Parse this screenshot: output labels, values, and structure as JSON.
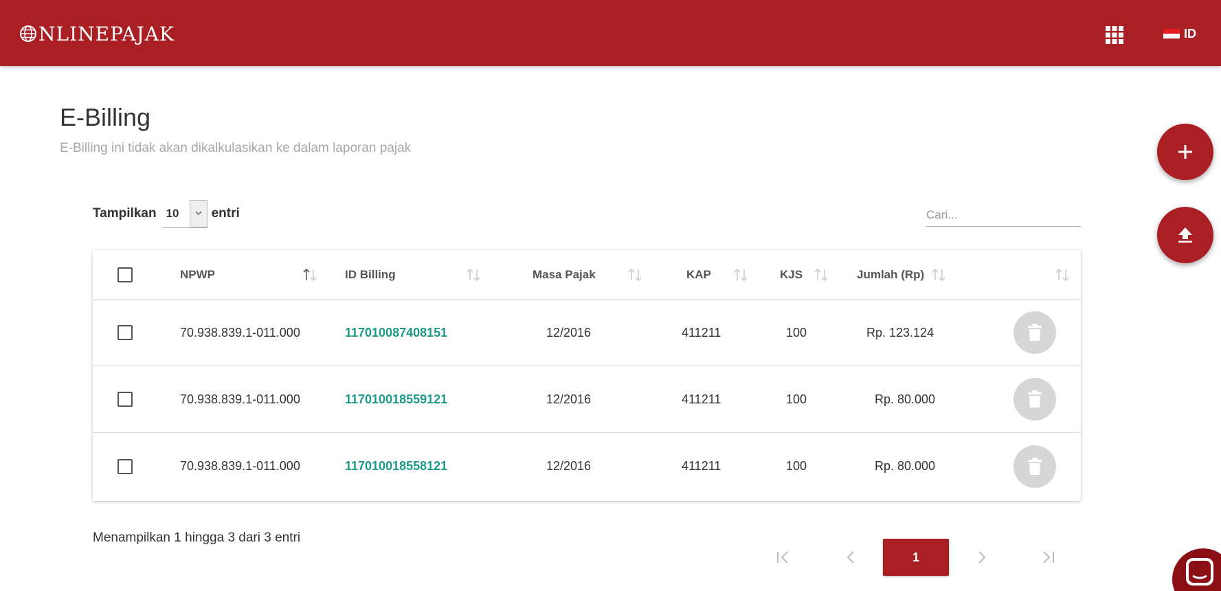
{
  "header": {
    "brand": "NLINEPAJAK",
    "brand_icon": "globe-icon",
    "apps_icon": "apps-grid-icon",
    "language": "ID",
    "brand_color": "#a91f24"
  },
  "page": {
    "title": "E-Billing",
    "subtitle": "E-Billing ini tidak akan dikalkulasikan ke dalam laporan pajak"
  },
  "fabs": {
    "add_icon": "plus-icon",
    "upload_icon": "upload-icon"
  },
  "controls": {
    "length_prefix": "Tampilkan",
    "length_value": "10",
    "length_suffix": "entri",
    "search_placeholder": "Cari..."
  },
  "table": {
    "columns": [
      "NPWP",
      "ID Billing",
      "Masa Pajak",
      "KAP",
      "KJS",
      "Jumlah (Rp)"
    ],
    "rows": [
      {
        "npwp": "70.938.839.1-011.000",
        "id_billing": "117010087408151",
        "masa_pajak": "12/2016",
        "kap": "411211",
        "kjs": "100",
        "jumlah": "Rp. 123.124"
      },
      {
        "npwp": "70.938.839.1-011.000",
        "id_billing": "117010018559121",
        "masa_pajak": "12/2016",
        "kap": "411211",
        "kjs": "100",
        "jumlah": "Rp. 80.000"
      },
      {
        "npwp": "70.938.839.1-011.000",
        "id_billing": "117010018558121",
        "masa_pajak": "12/2016",
        "kap": "411211",
        "kjs": "100",
        "jumlah": "Rp. 80.000"
      }
    ]
  },
  "footer": {
    "info": "Menampilkan 1 hingga 3 dari 3 entri",
    "current_page": "1"
  }
}
